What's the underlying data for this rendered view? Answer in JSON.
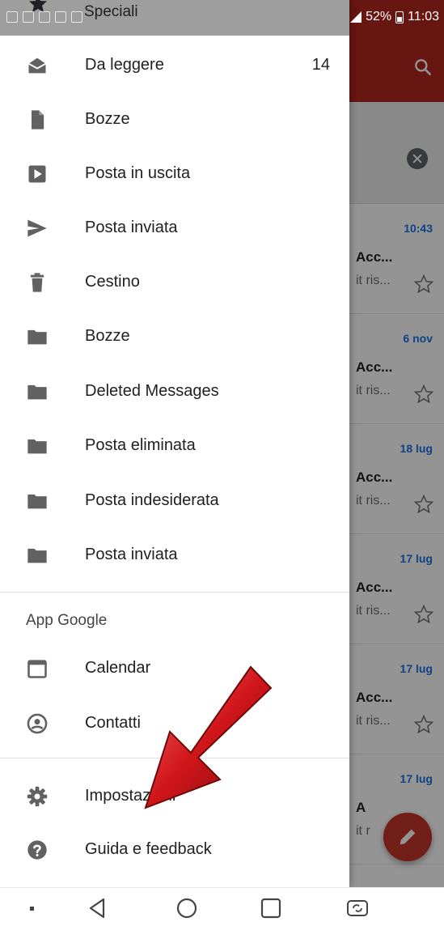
{
  "status_bar": {
    "battery": "52%",
    "time": "11:03"
  },
  "drawer": {
    "top_partial_label": "Speciali",
    "folders": [
      {
        "label": "Da leggere",
        "count": "14",
        "icon": "unread-icon"
      },
      {
        "label": "Bozze",
        "icon": "drafts-icon"
      },
      {
        "label": "Posta in uscita",
        "icon": "outbox-icon"
      },
      {
        "label": "Posta inviata",
        "icon": "send-icon"
      },
      {
        "label": "Cestino",
        "icon": "trash-icon"
      },
      {
        "label": "Bozze",
        "icon": "folder-icon"
      },
      {
        "label": "Deleted Messages",
        "icon": "folder-icon"
      },
      {
        "label": "Posta eliminata",
        "icon": "folder-icon"
      },
      {
        "label": "Posta indesiderata",
        "icon": "folder-icon"
      },
      {
        "label": "Posta inviata",
        "icon": "folder-icon"
      }
    ],
    "section_google": "App Google",
    "google_apps": [
      {
        "label": "Calendar",
        "icon": "calendar-icon"
      },
      {
        "label": "Contatti",
        "icon": "contacts-icon"
      }
    ],
    "settings": [
      {
        "label": "Impostazioni",
        "icon": "gear-icon"
      },
      {
        "label": "Guida e feedback",
        "icon": "help-icon"
      }
    ]
  },
  "inbox": {
    "emails": [
      {
        "date": "10:43",
        "sender": "Acc...",
        "snippet": "it ris..."
      },
      {
        "date": "6 nov",
        "sender": "Acc...",
        "snippet": "it ris..."
      },
      {
        "date": "18 lug",
        "sender": "Acc...",
        "snippet": "it ris..."
      },
      {
        "date": "17 lug",
        "sender": "Acc...",
        "snippet": "it ris..."
      },
      {
        "date": "17 lug",
        "sender": "Acc...",
        "snippet": "it ris..."
      },
      {
        "date": "17 lug",
        "sender": "A",
        "snippet": "it r"
      }
    ]
  },
  "colors": {
    "app_bar": "#b3261e",
    "fab": "#c4352c",
    "date_accent": "#1a73e8",
    "arrow": "#d0161b"
  }
}
